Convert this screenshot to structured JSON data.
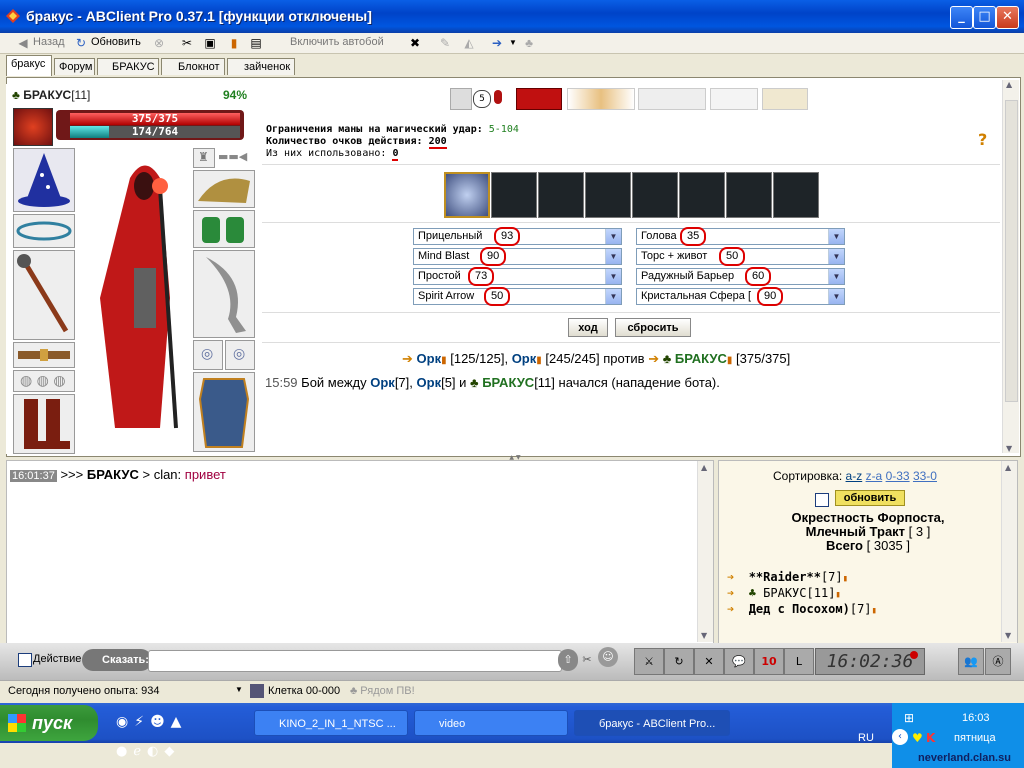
{
  "window": {
    "title": "бракус - ABClient Pro 0.37.1 [функции отключены]"
  },
  "toolbar": {
    "back": "Назад",
    "refresh": "Обновить",
    "autobattle": "Включить автобой"
  },
  "tabs": [
    "бракус",
    "Форум",
    "БРАКУС",
    "Блокнот",
    "зайченок"
  ],
  "character": {
    "name": "БРАКУС",
    "level": "[11]",
    "percent": "94%",
    "hp": "375/375",
    "mana": "174/764",
    "hp_fraction": 1.0,
    "mana_fraction": 0.23
  },
  "battle": {
    "mana_limit_label": "Ограничения маны на магический удар:",
    "mana_limit_value": "5-104",
    "action_points_label": "Количество очков действия:",
    "action_points_value": "200",
    "used_label": "Из них использовано:",
    "used_value": "0",
    "attacks": [
      {
        "label": "Прицельный",
        "value": "93"
      },
      {
        "label": "Mind Blast",
        "value": "90"
      },
      {
        "label": "Простой",
        "value": "73"
      },
      {
        "label": "Spirit Arrow",
        "value": "50"
      }
    ],
    "defenses": [
      {
        "label": "Голова",
        "value": "35"
      },
      {
        "label": "Торс + живот",
        "value": "50"
      },
      {
        "label": "Радужный Барьер",
        "value": "60"
      },
      {
        "label": "Кристальная Сфера [",
        "value": "90"
      }
    ],
    "move_button": "ход",
    "reset_button": "сбросить",
    "versus": {
      "enemy1": "Орк",
      "enemy1_hp": "[125/125],",
      "enemy2": "Орк",
      "enemy2_hp": "[245/245]",
      "vs": "против",
      "player": "БРАКУС",
      "player_hp": "[375/375]"
    },
    "log": {
      "time": "15:59",
      "text1": "Бой между",
      "orc1": "Орк",
      "orc1_level": "[7],",
      "orc2": "Орк",
      "orc2_level": "[5] и",
      "player": "БРАКУС",
      "player_level": "[11]",
      "text2": "начался (нападение бота)."
    }
  },
  "chat": {
    "time": "16:01:37",
    "prefix": ">>>",
    "user": "БРАКУС",
    "channel": "> clan:",
    "message": "привет"
  },
  "userlist": {
    "sort_label": "Сортировка:",
    "sort_options": [
      "a-z",
      "z-a",
      "0-33",
      "33-0"
    ],
    "refresh_button": "обновить",
    "location_line1": "Окрестность Форпоста,",
    "location_line2": "Млечный Тракт",
    "location_count": "[ 3 ]",
    "total_label": "Всего",
    "total_count": "[ 3035 ]",
    "users": [
      {
        "name": "**Raider**",
        "level": "[7]"
      },
      {
        "name": "БРАКУС",
        "level": "[11]"
      },
      {
        "name": "Дед с Посохом)",
        "level": "[7]"
      }
    ]
  },
  "bottombar": {
    "action_label": "Действие",
    "say_label": "Сказать:",
    "clock": "16:02:36",
    "badge": "10"
  },
  "statusbar": {
    "exp": "Сегодня получено опыта: 934",
    "cell": "Клетка 00-000",
    "nearby": "Рядом ПВ!"
  },
  "taskbar": {
    "start": "пуск",
    "tasks": [
      "KINO_2_IN_1_NTSC ...",
      "video",
      "бракус - ABClient Pro..."
    ],
    "lang": "RU",
    "time": "16:03",
    "day": "пятница",
    "watermark": "neverland.clan.su"
  }
}
